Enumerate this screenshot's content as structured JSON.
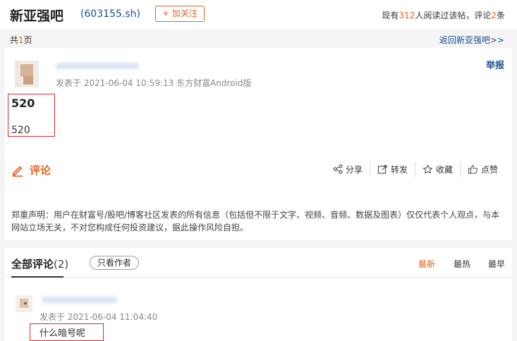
{
  "header": {
    "bar_name": "新亚强吧",
    "stock_code": "(603155.sh)",
    "follow_label": "+ 加关注",
    "stats_prefix": "现有",
    "readers": "312",
    "stats_mid": "人阅读过该帖，评论",
    "comment_count": "2",
    "stats_suffix": "条"
  },
  "pagination": {
    "prefix": "共",
    "total_pages": "1",
    "suffix": "页",
    "back_link": "返回新亚强吧>>"
  },
  "post": {
    "meta": "发表于 2021-06-04 10:59:13 东方财富Android版",
    "report_label": "举报",
    "title": "520",
    "body": "520",
    "comment_label": "评论",
    "actions": {
      "share": "分享",
      "forward": "转发",
      "collect": "收藏",
      "like": "点赞"
    },
    "disclaimer": "郑重声明：用户在财富号/股吧/博客社区发表的所有信息（包括但不限于文字、视频、音频、数据及图表）仅仅代表个人观点，与本网站立场无关，不对您构成任何投资建议，据此操作风险自担。"
  },
  "comments": {
    "tab_label": "全部评论",
    "tab_count": "(2)",
    "only_author": "只看作者",
    "sort": {
      "newest": "最新",
      "hottest": "最热",
      "earliest": "最早"
    },
    "items": [
      {
        "meta": "发表于 2021-06-04 11:04:40",
        "text": "什么暗号呢"
      }
    ]
  },
  "colors": {
    "accent": "#e0641e",
    "link": "#1b4f93",
    "highlight_box": "#d9272e"
  }
}
